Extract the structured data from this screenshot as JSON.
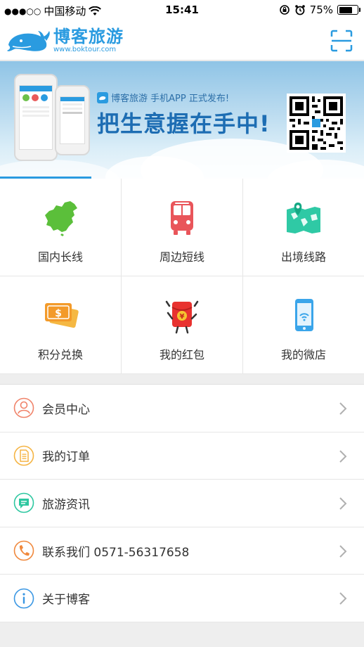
{
  "status_bar": {
    "carrier": "中国移动",
    "time": "15:41",
    "battery": "75%",
    "battery_level": 0.75
  },
  "header": {
    "brand_name": "博客旅游",
    "brand_url": "www.boktour.com"
  },
  "banner": {
    "headline_small": "博客旅游 手机APP 正式发布!",
    "headline_main": "把生意握在手中!"
  },
  "categories": [
    {
      "label": "国内长线",
      "icon": "china-map-icon"
    },
    {
      "label": "周边短线",
      "icon": "bus-icon"
    },
    {
      "label": "出境线路",
      "icon": "world-map-icon"
    },
    {
      "label": "积分兑换",
      "icon": "points-card-icon"
    },
    {
      "label": "我的红包",
      "icon": "red-packet-icon"
    },
    {
      "label": "我的微店",
      "icon": "phone-shop-icon"
    }
  ],
  "menu": [
    {
      "label": "会员中心",
      "icon": "user-icon",
      "color": "#f0836a"
    },
    {
      "label": "我的订单",
      "icon": "order-icon",
      "color": "#f5b443"
    },
    {
      "label": "旅游资讯",
      "icon": "news-icon",
      "color": "#2dc7a0"
    },
    {
      "label": "联系我们 0571-56317658",
      "icon": "phone-icon",
      "color": "#f0883c"
    },
    {
      "label": "关于博客",
      "icon": "info-icon",
      "color": "#3a97e3"
    }
  ],
  "colors": {
    "brand": "#2a9be0",
    "chevron": "#b0b0b0"
  }
}
